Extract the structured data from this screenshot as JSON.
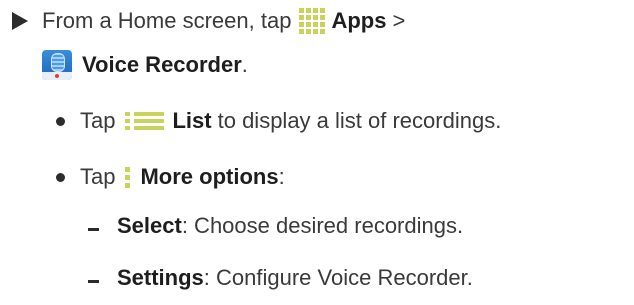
{
  "step": {
    "prefix": "From a Home screen, tap",
    "apps_label": "Apps",
    "apps_sep": ">",
    "voice_label": "Voice Recorder",
    "voice_suffix": "."
  },
  "bullets": [
    {
      "tap": "Tap",
      "label": "List",
      "text": "to display a list of recordings."
    },
    {
      "tap": "Tap",
      "label": "More options",
      "text": ":"
    }
  ],
  "subitems": [
    {
      "label": "Select",
      "text": ": Choose desired recordings."
    },
    {
      "label": "Settings",
      "text": ": Configure Voice Recorder."
    }
  ],
  "icons": {
    "apps": "apps-grid-icon",
    "voice": "voice-recorder-icon",
    "list": "list-icon",
    "more": "more-options-icon"
  },
  "colors": {
    "icon_accent": "#c9d25a",
    "text": "#3a3a3a",
    "voice_icon": "#1b63b8"
  }
}
